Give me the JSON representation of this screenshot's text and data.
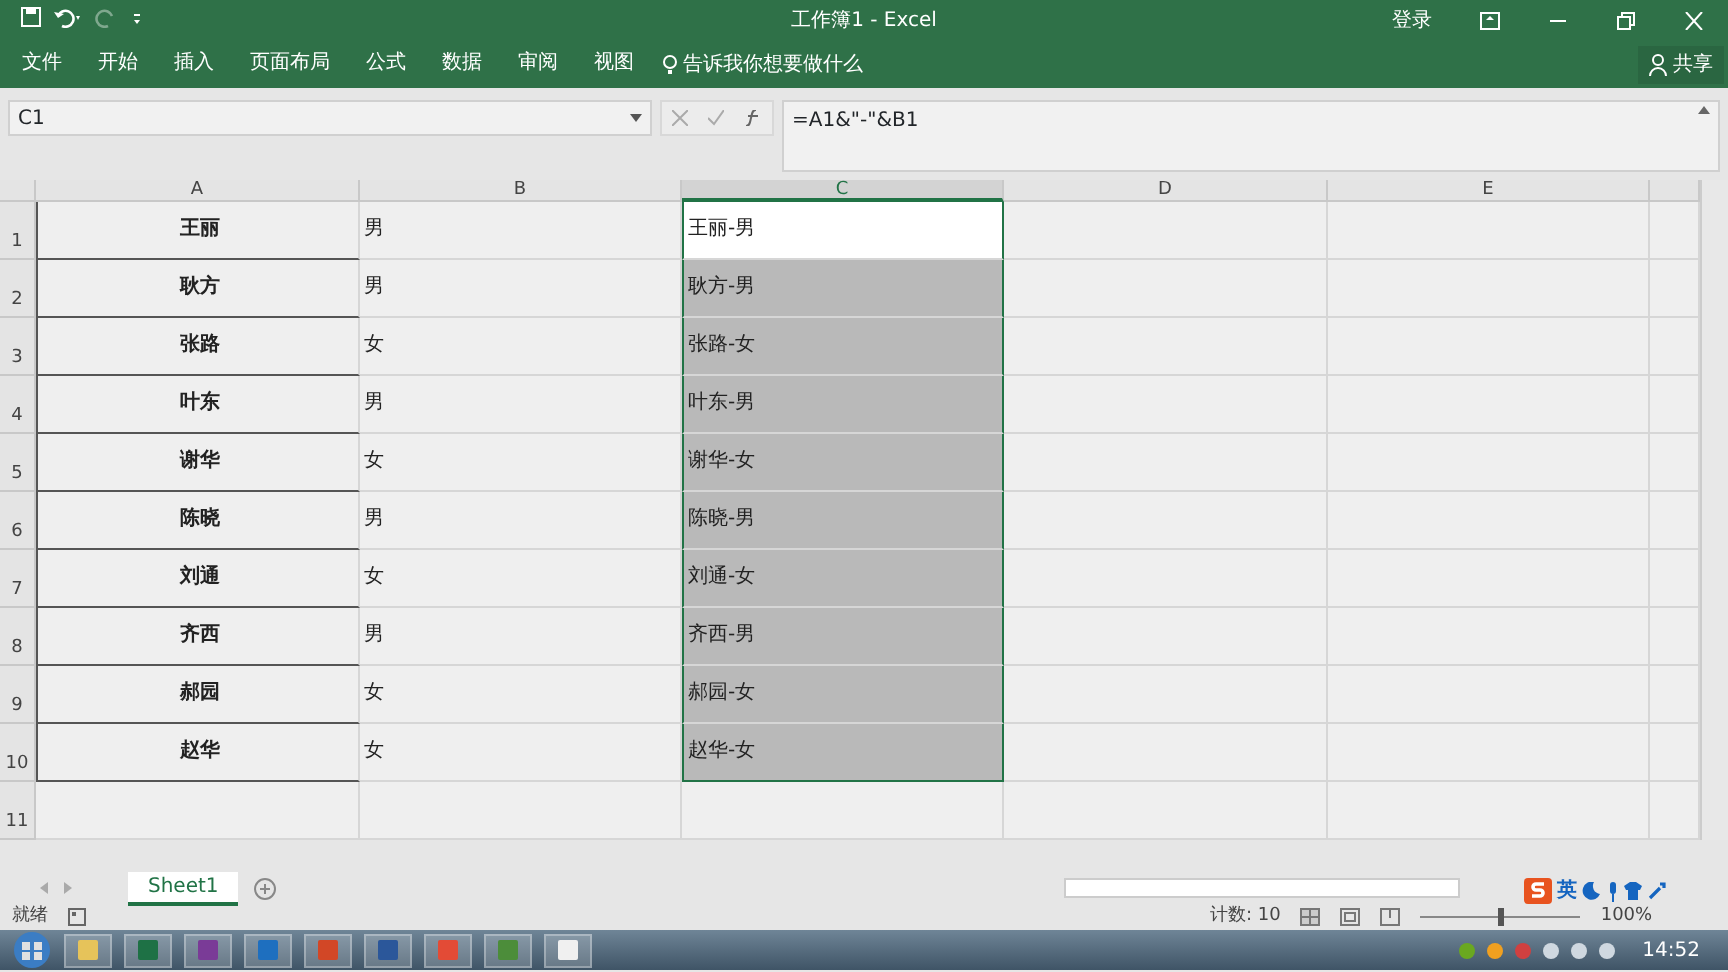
{
  "window": {
    "title": "工作簿1  -  Excel",
    "sign_in": "登录"
  },
  "ribbon_tabs": [
    {
      "label": "文件",
      "selected": false
    },
    {
      "label": "开始",
      "selected": false
    },
    {
      "label": "插入",
      "selected": false
    },
    {
      "label": "页面布局",
      "selected": false
    },
    {
      "label": "公式",
      "selected": false
    },
    {
      "label": "数据",
      "selected": false
    },
    {
      "label": "审阅",
      "selected": false
    },
    {
      "label": "视图",
      "selected": false
    }
  ],
  "tell_me": "告诉我你想要做什么",
  "share": "共享",
  "name_box": "C1",
  "formula": "=A1&\"-\"&B1",
  "columns": [
    "A",
    "B",
    "C",
    "D",
    "E"
  ],
  "rows": [
    {
      "num": "1",
      "a": "王丽",
      "b": "男",
      "c": "王丽-男",
      "selected": true,
      "active": true
    },
    {
      "num": "2",
      "a": "耿方",
      "b": "男",
      "c": "耿方-男",
      "selected": true,
      "active": false
    },
    {
      "num": "3",
      "a": "张路",
      "b": "女",
      "c": "张路-女",
      "selected": true,
      "active": false
    },
    {
      "num": "4",
      "a": "叶东",
      "b": "男",
      "c": "叶东-男",
      "selected": true,
      "active": false
    },
    {
      "num": "5",
      "a": "谢华",
      "b": "女",
      "c": "谢华-女",
      "selected": true,
      "active": false
    },
    {
      "num": "6",
      "a": "陈晓",
      "b": "男",
      "c": "陈晓-男",
      "selected": true,
      "active": false
    },
    {
      "num": "7",
      "a": "刘通",
      "b": "女",
      "c": "刘通-女",
      "selected": true,
      "active": false
    },
    {
      "num": "8",
      "a": "齐西",
      "b": "男",
      "c": "齐西-男",
      "selected": true,
      "active": false
    },
    {
      "num": "9",
      "a": "郝园",
      "b": "女",
      "c": "郝园-女",
      "selected": true,
      "active": false
    },
    {
      "num": "10",
      "a": "赵华",
      "b": "女",
      "c": "赵华-女",
      "selected": true,
      "active": false
    },
    {
      "num": "11"
    }
  ],
  "sheet_tabs": [
    {
      "label": "Sheet1",
      "selected": true
    }
  ],
  "status": {
    "ready": "就绪",
    "count": "计数: 10",
    "zoom": "100%",
    "zoom_slider": {
      "level": 0.5
    }
  },
  "ime": "英",
  "taskbar": {
    "clock": "14:52"
  }
}
